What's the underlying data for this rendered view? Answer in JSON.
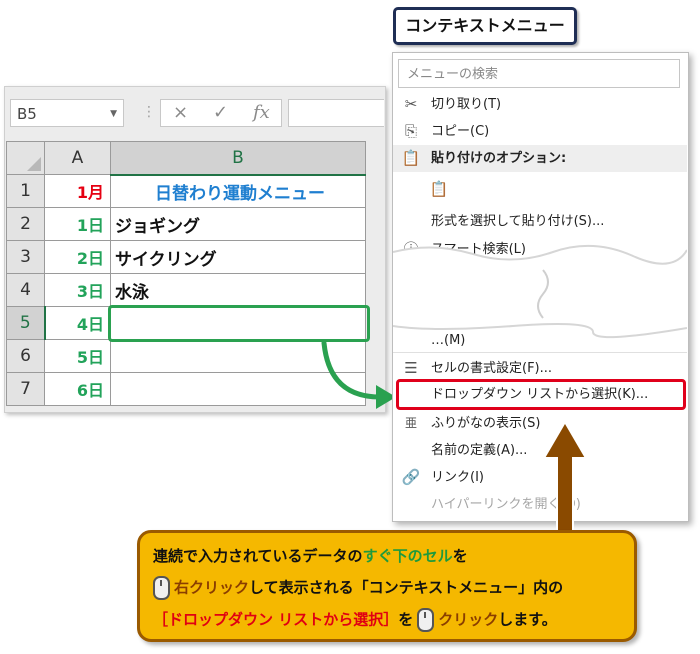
{
  "title_box": "コンテキストメニュー",
  "sheet": {
    "name_box": "B5",
    "fx_icons": [
      "×",
      "✓",
      "fx"
    ],
    "columns": [
      "A",
      "B"
    ],
    "rows": [
      {
        "num": "1",
        "a": "1月",
        "b": "日替わり運動メニュー"
      },
      {
        "num": "2",
        "a": "1日",
        "b": "ジョギング"
      },
      {
        "num": "3",
        "a": "2日",
        "b": "サイクリング"
      },
      {
        "num": "4",
        "a": "3日",
        "b": "水泳"
      },
      {
        "num": "5",
        "a": "4日",
        "b": ""
      },
      {
        "num": "6",
        "a": "5日",
        "b": ""
      },
      {
        "num": "7",
        "a": "6日",
        "b": ""
      }
    ]
  },
  "menu": {
    "search_placeholder": "メニューの検索",
    "items": [
      {
        "label": "切り取り(T)",
        "icon": "scissors-icon"
      },
      {
        "label": "コピー(C)",
        "icon": "copy-icon"
      },
      {
        "label": "貼り付けのオプション:",
        "icon": "paste-icon"
      },
      {
        "label": "",
        "icon": "paste-option-icon"
      },
      {
        "label": "形式を選択して貼り付け(S)...",
        "icon": ""
      },
      {
        "label": "スマート検索(L)",
        "icon": "smart-lookup-icon"
      },
      {
        "label": "…(M)",
        "icon": ""
      },
      {
        "label": "セルの書式設定(F)...",
        "icon": "format-cells-icon"
      },
      {
        "label": "ドロップダウン リストから選択(K)...",
        "icon": ""
      },
      {
        "label": "ふりがなの表示(S)",
        "icon": "furigana-icon"
      },
      {
        "label": "名前の定義(A)...",
        "icon": ""
      },
      {
        "label": "リンク(I)",
        "icon": "link-icon"
      },
      {
        "label": "ハイパーリンクを開く(O)",
        "icon": ""
      }
    ]
  },
  "callout": {
    "line1_a": "連続で入力されているデータの",
    "line1_b": "すぐ下のセル",
    "line1_c": "を",
    "line2_a": "右クリック",
    "line2_b": "して表示される「コンテキストメニュー」内の",
    "line3_a": "［ドロップダウン リストから選択］",
    "line3_b": "を",
    "line3_c": "クリック",
    "line3_d": "します。"
  },
  "colors": {
    "green": "#2aa150",
    "red": "#e0001b",
    "callout_bg": "#f5b800",
    "arrow_brown": "#8a4a00"
  }
}
